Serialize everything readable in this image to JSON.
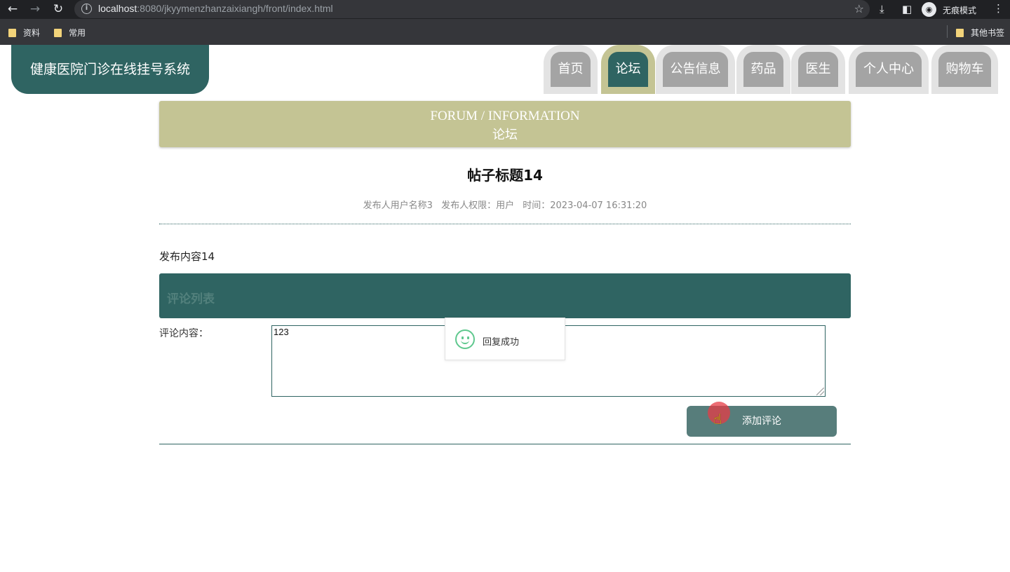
{
  "browser": {
    "url_host": "localhost",
    "url_path": ":8080/jkyymenzhanzaixiangh/front/index.html",
    "incognito_label": "无痕模式",
    "bookmarks": [
      "资料",
      "常用"
    ],
    "other_bookmarks": "其他书签"
  },
  "site": {
    "logo": "健康医院门诊在线挂号系统",
    "nav": [
      "首页",
      "论坛",
      "公告信息",
      "药品",
      "医生",
      "个人中心",
      "购物车"
    ],
    "active_nav": "论坛"
  },
  "banner": {
    "en": "FORUM / INFORMATION",
    "cn": "论坛"
  },
  "post": {
    "title": "帖子标题14",
    "author": "发布人用户名称3",
    "role": "发布人权限：用户",
    "time": "时间：2023-04-07 16:31:20",
    "content": "发布内容14"
  },
  "comments": {
    "header": "评论列表",
    "label": "评论内容：",
    "value": "123",
    "submit_label": "添加评论"
  },
  "toast": {
    "text": "回复成功",
    "accent": "#5fc88e"
  },
  "colors": {
    "primary": "#2f6462",
    "banner": "#c4c494",
    "tab_inactive": "#a4a4a4"
  }
}
